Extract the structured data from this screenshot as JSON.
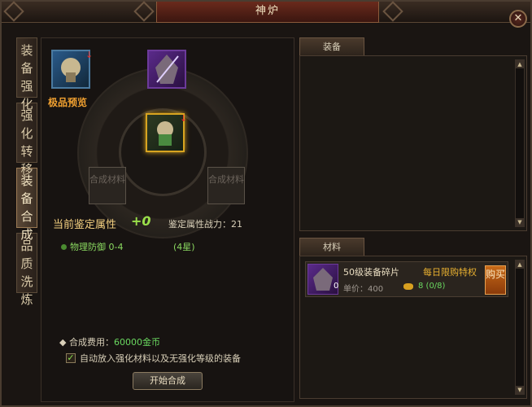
{
  "window": {
    "title": "神炉"
  },
  "side_tabs": [
    {
      "label": "装备强化",
      "active": false
    },
    {
      "label": "强化转移",
      "active": false
    },
    {
      "label": "装备合成",
      "active": true
    },
    {
      "label": "品质洗炼",
      "active": false
    }
  ],
  "synth": {
    "preview_label": "极品预览",
    "material_slot_label_1": "合成材料",
    "material_slot_label_2": "合成材料"
  },
  "attributes": {
    "title": "当前鉴定属性",
    "plus": "+0",
    "power_label": "鉴定属性战力：21",
    "rows": [
      {
        "name": "物理防御 0-4",
        "stars": "(4星)"
      }
    ]
  },
  "cost": {
    "label": "合成费用：",
    "value": "60000金币"
  },
  "auto_fill": {
    "label": "自动放入强化材料以及无强化等级的装备",
    "checked": true
  },
  "start_button": "开始合成",
  "equip_panel": {
    "tab": "装备"
  },
  "material_panel": {
    "tab": "材料",
    "items": [
      {
        "count": "0",
        "name": "50级装备碎片",
        "daily": "每日限购特权",
        "price_label": "单价：400",
        "limit": "8 (0/8)",
        "buy": "购买"
      }
    ]
  },
  "colors": {
    "accent_gold": "#f0a030",
    "green_text": "#8ad860",
    "panel_bg": "#1a1512"
  }
}
